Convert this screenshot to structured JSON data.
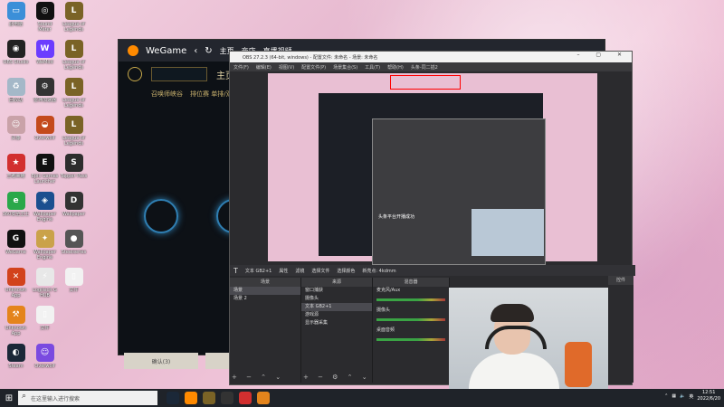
{
  "desktop": {
    "icons": [
      {
        "label": "此电脑",
        "color": "#3b8fd8",
        "glyph": "▭"
      },
      {
        "label": "Sound Meter",
        "color": "#111111",
        "glyph": "◎"
      },
      {
        "label": "League of Legends",
        "color": "#7a6326",
        "glyph": "L"
      },
      {
        "label": "OBS Studio",
        "color": "#222222",
        "glyph": "◉"
      },
      {
        "label": "WeMod",
        "color": "#6b3cff",
        "glyph": "W"
      },
      {
        "label": "League of Legends",
        "color": "#7a6326",
        "glyph": "L"
      },
      {
        "label": "回收站",
        "color": "#a4b8c8",
        "glyph": "♻"
      },
      {
        "label": "雷神加速器",
        "color": "#333333",
        "glyph": "⚙"
      },
      {
        "label": "League of Legends",
        "color": "#7a6326",
        "glyph": "L"
      },
      {
        "label": "头像",
        "color": "#c9a2a8",
        "glyph": "☺"
      },
      {
        "label": "Overwolf",
        "color": "#c44a1c",
        "glyph": "◒"
      },
      {
        "label": "League of Legends",
        "color": "#7a6326",
        "glyph": "L"
      },
      {
        "label": "王者荣耀",
        "color": "#d22f2f",
        "glyph": "★"
      },
      {
        "label": "Epic Games Launcher",
        "color": "#111111",
        "glyph": "E"
      },
      {
        "label": "Tapper Pass",
        "color": "#2d2d2d",
        "glyph": "S"
      },
      {
        "label": "360安全卫士",
        "color": "#2aa84a",
        "glyph": "e"
      },
      {
        "label": "Wallpaper Engine",
        "color": "#1b4f8f",
        "glyph": "◈"
      },
      {
        "label": "Wallpaper",
        "color": "#333333",
        "glyph": "D"
      },
      {
        "label": "WeGame",
        "color": "#111111",
        "glyph": "G"
      },
      {
        "label": "Wallpaper Engine",
        "color": "#caa24a",
        "glyph": "✦"
      },
      {
        "label": "Steelseries",
        "color": "#555555",
        "glyph": "●"
      },
      {
        "label": "Unknown App",
        "color": "#d2421c",
        "glyph": "✕"
      },
      {
        "label": "Logitech G HUB",
        "color": "#e8e8e8",
        "glyph": "⚡"
      },
      {
        "label": "文件",
        "color": "#f2f2f2",
        "glyph": "▯"
      },
      {
        "label": "Unknown App",
        "color": "#e4841c",
        "glyph": "⚒"
      },
      {
        "label": "文件",
        "color": "#f2f2f2",
        "glyph": "▯"
      },
      {
        "label": "",
        "color": "transparent",
        "glyph": ""
      },
      {
        "label": "Steam",
        "color": "#1b2838",
        "glyph": "◐"
      },
      {
        "label": "Overwolf",
        "color": "#7a4ae0",
        "glyph": "☺"
      }
    ]
  },
  "wegame": {
    "brand": "WeGame",
    "tabs": [
      "主页",
      "商店",
      "直播视频"
    ],
    "lol": {
      "main_tab": "主页",
      "subtabs": [
        "召唤师峡谷",
        "排位赛 单排/双排"
      ],
      "btn_left": "确认(3)",
      "btn_right": "辅助"
    }
  },
  "obs": {
    "title": "OBS 27.2.3 (64-bit, windows) - 配置文件: 未命名 - 场景: 未命名",
    "menu": [
      "文件(F)",
      "编辑(E)",
      "视图(V)",
      "配置文件(P)",
      "场景集合(S)",
      "工具(T)",
      "帮助(H)",
      "头条-同二插2"
    ],
    "source_bar": {
      "label": "文本 GB2+1",
      "props": "属性",
      "filters": "滤镜",
      "select_file": "选择文件",
      "select_color": "选择颜色",
      "text_value": "新亮点: 4kdmm"
    },
    "docks": {
      "scenes": {
        "title": "场景",
        "items": [
          "场景",
          "场景 2"
        ]
      },
      "sources": {
        "title": "来源",
        "items": [
          "窗口捕获",
          "摄像头",
          "文本 GB2+1",
          "游戏源",
          "显示器采集"
        ]
      },
      "mixer": {
        "title": "混音器",
        "channels": [
          "麦克风/Aux",
          "摄像头",
          "桌面音频"
        ]
      },
      "transitions": {
        "title": "转场特效"
      },
      "controls": {
        "title": "控件"
      }
    },
    "notice": "头条平台开播成功"
  },
  "taskbar": {
    "search_placeholder": "在这里输入进行搜索",
    "time": "12:51",
    "date": "2022/6/20",
    "lang": "英"
  }
}
